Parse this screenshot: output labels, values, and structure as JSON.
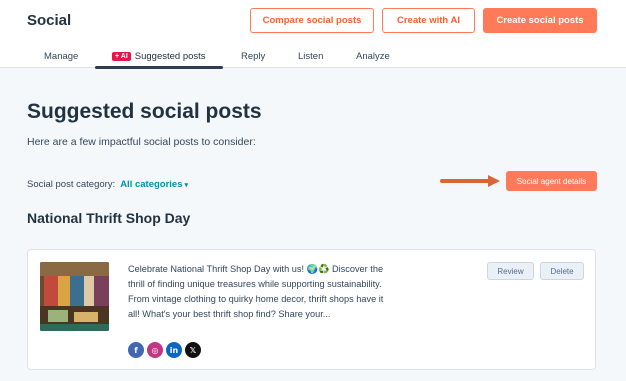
{
  "header": {
    "title": "Social",
    "buttons": {
      "compare": "Compare social posts",
      "create_ai": "Create with AI",
      "create": "Create social posts"
    }
  },
  "tabs": [
    {
      "label": "Manage"
    },
    {
      "label": "Suggested posts",
      "badge": "+ AI"
    },
    {
      "label": "Reply"
    },
    {
      "label": "Listen"
    },
    {
      "label": "Analyze"
    }
  ],
  "main": {
    "title": "Suggested social posts",
    "subtitle": "Here are a few impactful social posts to consider:",
    "category_label": "Social post category:",
    "category_value": "All categories",
    "agent_button": "Social agent details",
    "section_title": "National Thrift Shop Day"
  },
  "post": {
    "text": "Celebrate National Thrift Shop Day with us! 🌍♻️ Discover the thrill of finding unique treasures while supporting sustainability. From vintage clothing to quirky home decor, thrift shops have it all! What's your best thrift shop find? Share your...",
    "review_label": "Review",
    "delete_label": "Delete",
    "networks": [
      {
        "name": "facebook-icon",
        "glyph": "f"
      },
      {
        "name": "instagram-icon",
        "glyph": "◎"
      },
      {
        "name": "linkedin-icon",
        "glyph": "in"
      },
      {
        "name": "x-icon",
        "glyph": "𝕏"
      }
    ]
  },
  "colors": {
    "accent": "#ff7a59",
    "link": "#0091ae",
    "ai_badge": "#e5174a"
  }
}
